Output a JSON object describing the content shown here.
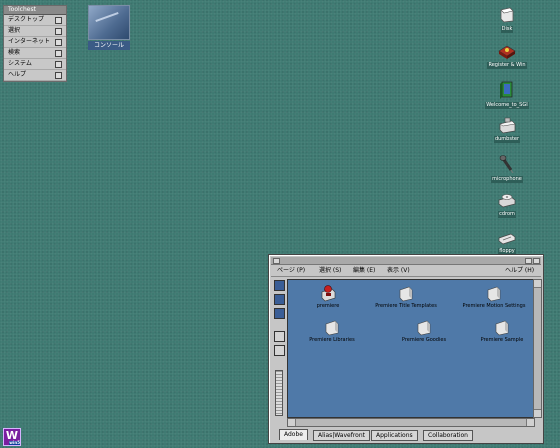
{
  "toolchest": {
    "title": "Toolchest",
    "items": [
      "デスクトップ",
      "選択",
      "インターネット",
      "検索",
      "システム",
      "ヘルプ"
    ]
  },
  "minimized": {
    "label": "コンソール"
  },
  "desktop_icons": [
    {
      "label": "Disk",
      "icon": "disk-icon"
    },
    {
      "label": "Register & Win",
      "icon": "register-icon"
    },
    {
      "label": "Welcome_to_SGI",
      "icon": "welcome-book-icon"
    },
    {
      "label": "dumbster",
      "icon": "dumpster-icon"
    },
    {
      "label": "microphone",
      "icon": "microphone-icon"
    },
    {
      "label": "cdrom",
      "icon": "cdrom-icon"
    },
    {
      "label": "floppy",
      "icon": "floppy-icon"
    }
  ],
  "window": {
    "menu": {
      "page": "ページ (P)",
      "select": "選択 (S)",
      "edit": "編集 (E)",
      "view": "表示 (V)",
      "help": "ヘルプ (H)"
    },
    "items": [
      {
        "label": "premiere",
        "icon": "premiere-app-icon"
      },
      {
        "label": "Premiere Title Templates",
        "icon": "folder-icon"
      },
      {
        "label": "Premiere Motion Settings",
        "icon": "folder-icon"
      },
      {
        "label": "Premiere Libraries",
        "icon": "folder-icon"
      },
      {
        "label": "Premiere Goodies",
        "icon": "folder-icon"
      },
      {
        "label": "Premiere Sample",
        "icon": "folder-icon"
      }
    ],
    "tabs": [
      "Adobe",
      "Alias|Wavefront",
      "Applications",
      "Collaboration"
    ]
  },
  "logo": {
    "letter": "W",
    "sub": "win5"
  }
}
